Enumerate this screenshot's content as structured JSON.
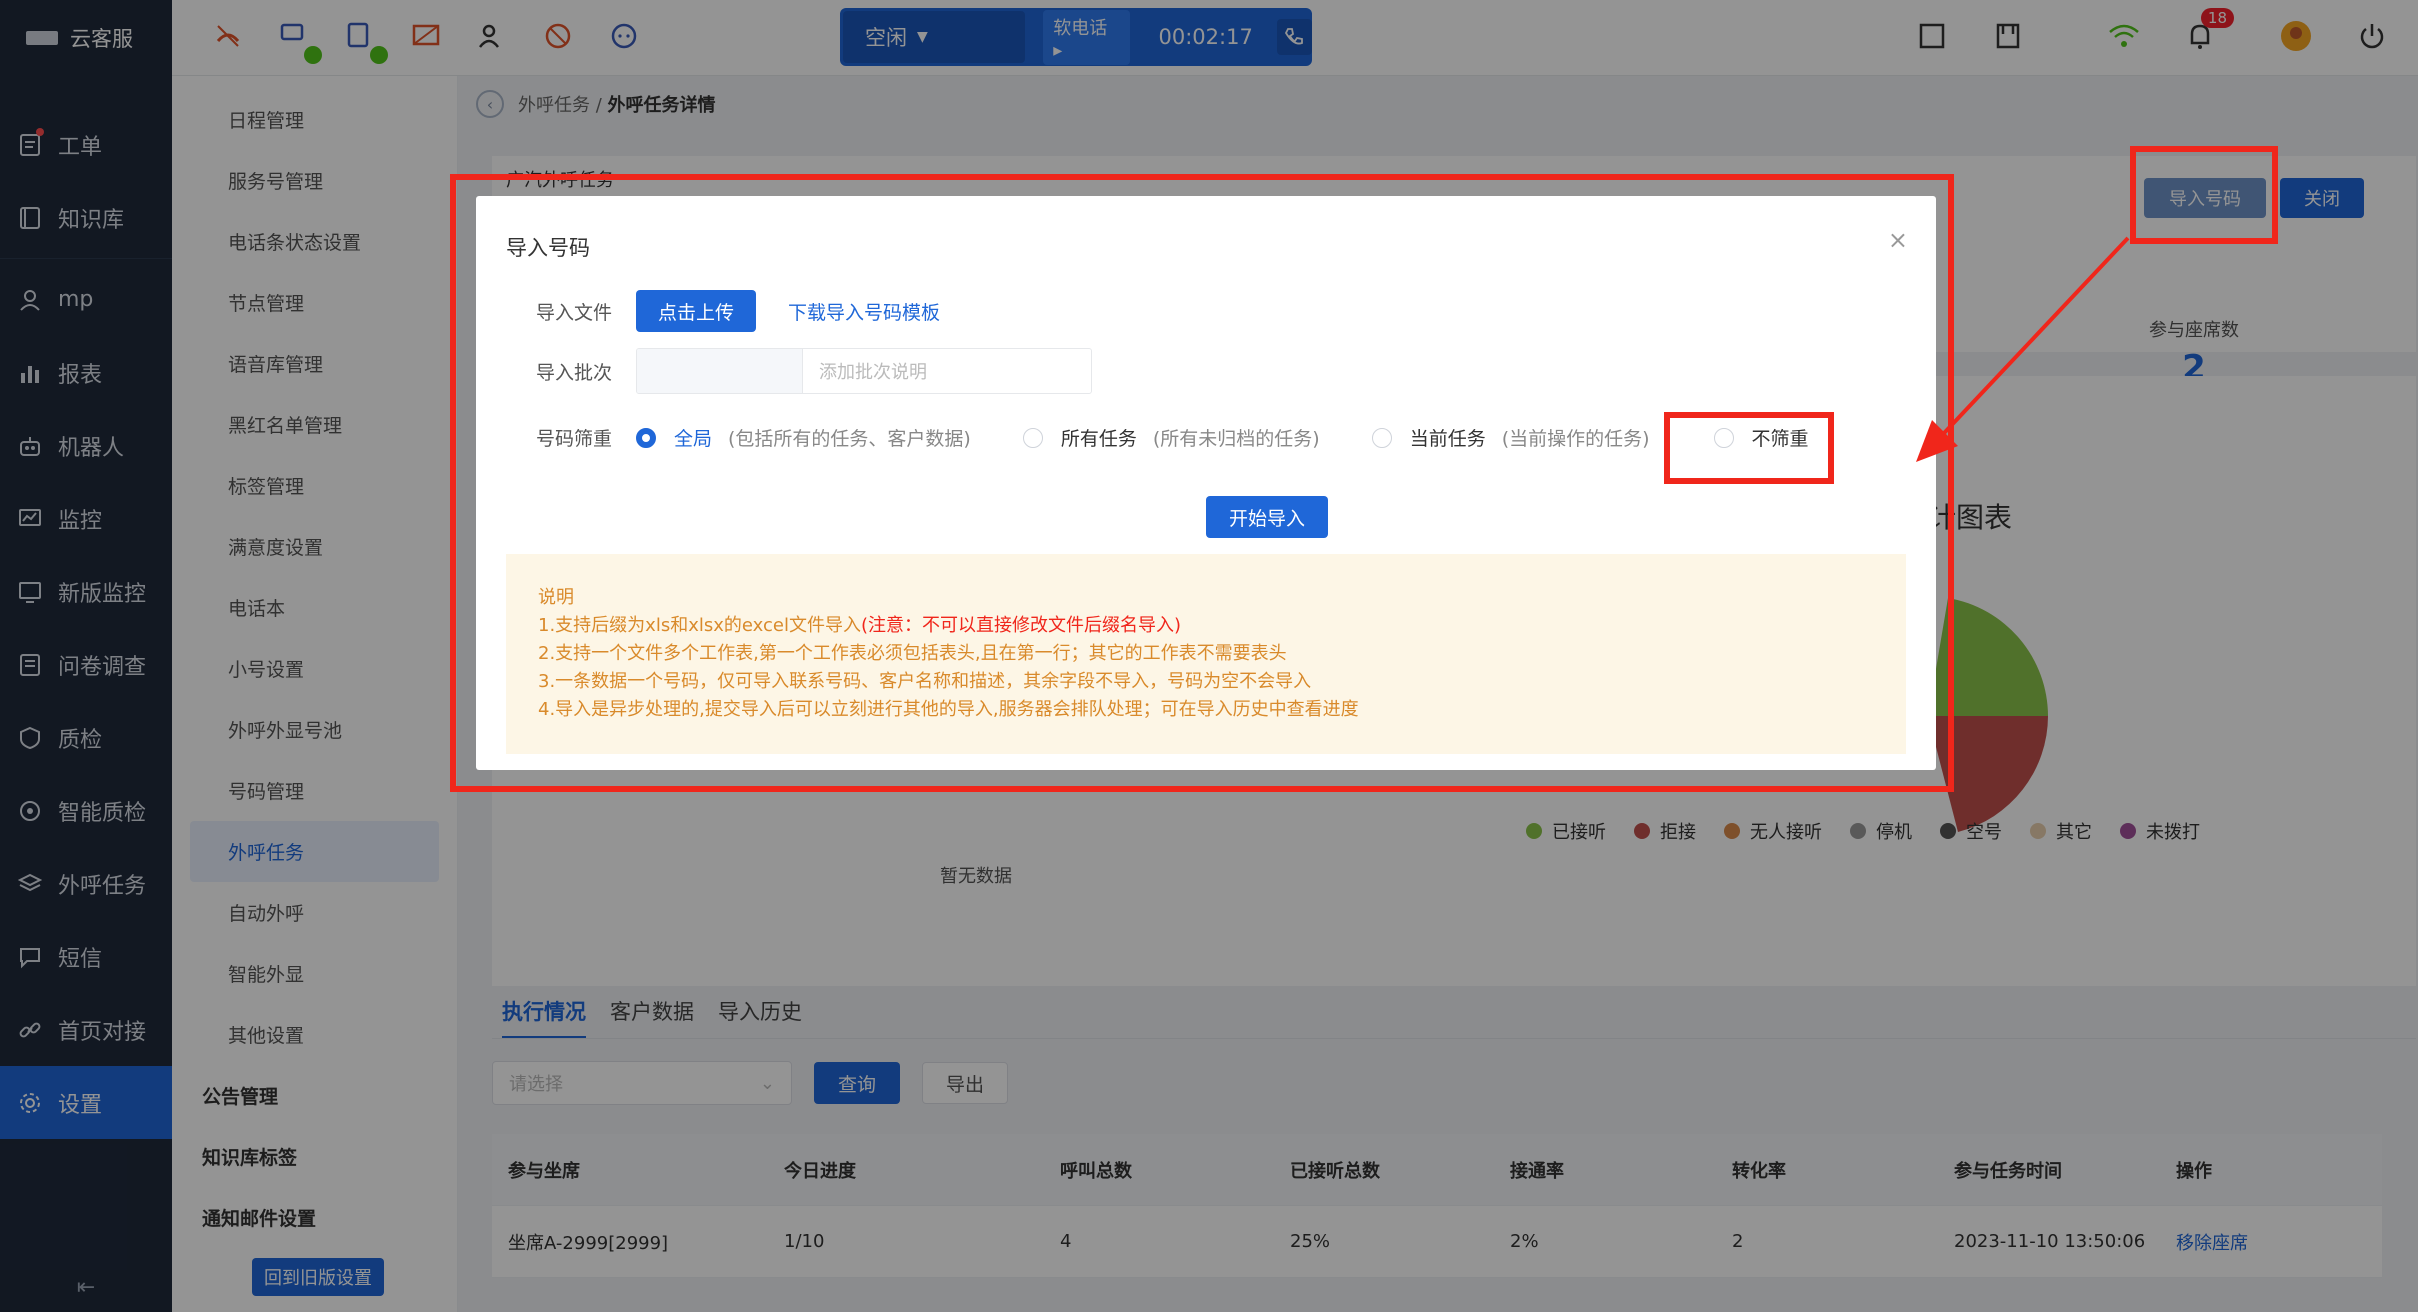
{
  "app": {
    "title": "云客服"
  },
  "sidebar": {
    "items": [
      {
        "label": "工单",
        "icon": "ticket-icon"
      },
      {
        "label": "知识库",
        "icon": "book-icon"
      },
      {
        "label": "mp",
        "icon": "user-icon"
      },
      {
        "label": "报表",
        "icon": "bar-chart-icon"
      },
      {
        "label": "机器人",
        "icon": "robot-icon"
      },
      {
        "label": "监控",
        "icon": "monitor-icon"
      },
      {
        "label": "新版监控",
        "icon": "monitor-icon"
      },
      {
        "label": "问卷调查",
        "icon": "survey-icon"
      },
      {
        "label": "质检",
        "icon": "shield-icon"
      },
      {
        "label": "智能质检",
        "icon": "target-icon"
      },
      {
        "label": "外呼任务",
        "icon": "layers-icon"
      },
      {
        "label": "短信",
        "icon": "message-icon"
      },
      {
        "label": "首页对接",
        "icon": "link-icon"
      },
      {
        "label": "设置",
        "icon": "gear-icon"
      }
    ],
    "collapse_icon": "collapse-icon"
  },
  "topbar": {
    "status": "空闲",
    "soft_phone": "软电话",
    "timer": "00:02:17",
    "notification_count": "18"
  },
  "submenu": {
    "items": [
      "日程管理",
      "服务号管理",
      "电话条状态设置",
      "节点管理",
      "语音库管理",
      "黑红名单管理",
      "标签管理",
      "满意度设置",
      "电话本",
      "小号设置",
      "外呼外显号池",
      "号码管理",
      "外呼任务",
      "自动外呼",
      "智能外显",
      "其他设置"
    ],
    "groups": [
      "公告管理",
      "知识库标签",
      "通知邮件设置"
    ],
    "back_old": "回到旧版设置"
  },
  "main": {
    "breadcrumb_parent": "外呼任务 /",
    "breadcrumb_current": "外呼任务详情",
    "task_title": "广汽外呼任务",
    "import_btn": "导入号码",
    "close_btn": "关闭",
    "seat_label": "参与座席数",
    "seat_value": "2",
    "chart_title": "计图表",
    "legend": [
      {
        "label": "已接听",
        "color": "#8bc34a"
      },
      {
        "label": "拒接",
        "color": "#c0504d"
      },
      {
        "label": "无人接听",
        "color": "#d98a4b"
      },
      {
        "label": "停机",
        "color": "#999999"
      },
      {
        "label": "空号",
        "color": "#555555"
      },
      {
        "label": "其它",
        "color": "#e8cfae"
      },
      {
        "label": "未拨打",
        "color": "#a0509a"
      }
    ],
    "no_data": "暂无数据",
    "tabs": [
      "执行情况",
      "客户数据",
      "导入历史"
    ],
    "select_placeholder": "请选择",
    "query_btn": "查询",
    "export_btn": "导出",
    "table": {
      "headers": [
        "参与坐席",
        "今日进度",
        "呼叫总数",
        "已接听总数",
        "接通率",
        "转化率",
        "参与任务时间",
        "操作"
      ],
      "rows": [
        [
          "坐席A-2999[2999]",
          "1/10",
          "4",
          "25%",
          "2%",
          "2",
          "2023-11-10 13:50:06",
          "移除座席"
        ]
      ]
    }
  },
  "dialog": {
    "title": "导入号码",
    "file_label": "导入文件",
    "upload_btn": "点击上传",
    "template_link": "下载导入号码模板",
    "batch_label": "导入批次",
    "batch_placeholder": "添加批次说明",
    "filter_label": "号码筛重",
    "options": [
      {
        "label": "全局",
        "hint": "(包括所有的任务、客户数据)",
        "checked": true
      },
      {
        "label": "所有任务",
        "hint": "(所有未归档的任务)",
        "checked": false
      },
      {
        "label": "当前任务",
        "hint": "(当前操作的任务)",
        "checked": false
      },
      {
        "label": "不筛重",
        "hint": "",
        "checked": false
      }
    ],
    "start_btn": "开始导入",
    "note_title": "说明",
    "note_line1": "1.支持后缀为xls和xlsx的excel文件导入",
    "note_line1_warn": "(注意：不可以直接修改文件后缀名导入)",
    "note_line2": "2.支持一个文件多个工作表,第一个工作表必须包括表头,且在第一行；其它的工作表不需要表头",
    "note_line3": "3.一条数据一个号码，仅可导入联系号码、客户名称和描述，其余字段不导入，号码为空不会导入",
    "note_line4": "4.导入是异步处理的,提交导入后可以立刻进行其他的导入,服务器会排队处理；可在导入历史中查看进度"
  },
  "colors": {
    "primary": "#1f67d8",
    "annotation": "#f0261b",
    "sidebar_bg": "#1f2a3c"
  }
}
